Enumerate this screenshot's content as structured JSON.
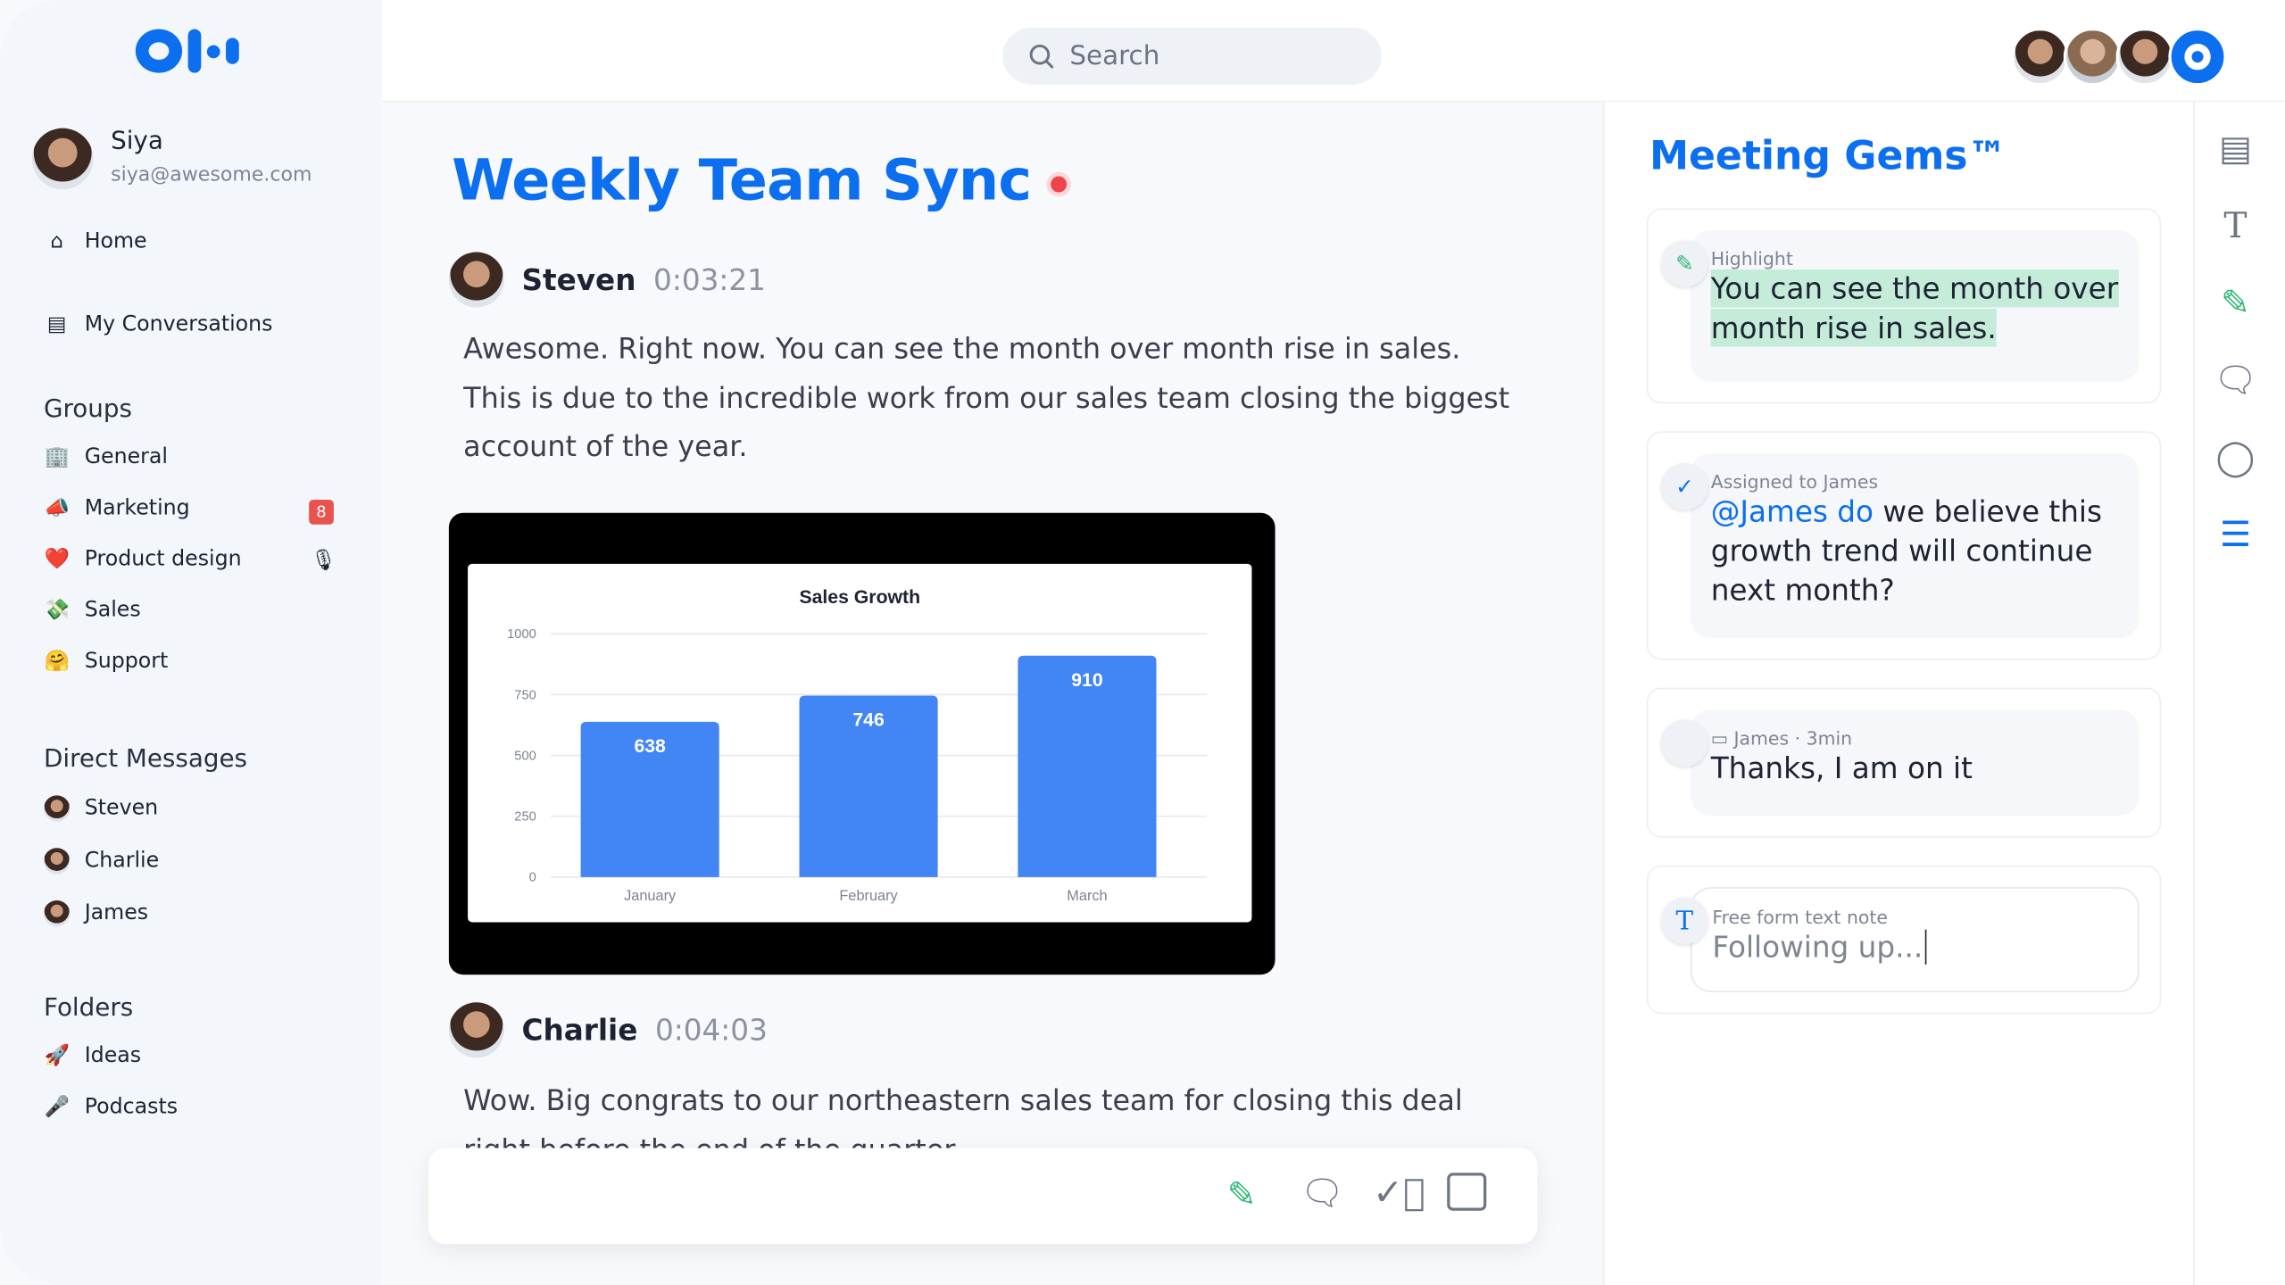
{
  "app": {
    "search_placeholder": "Search",
    "brand_color": "#0b6ff0"
  },
  "user": {
    "name": "Siya",
    "email": "siya@awesome.com"
  },
  "nav": [
    {
      "label": "Home",
      "icon": "home-icon"
    },
    {
      "label": "My Conversations",
      "icon": "document-icon"
    }
  ],
  "groups": {
    "title": "Groups",
    "items": [
      {
        "label": "General",
        "icon": "🏢"
      },
      {
        "label": "Marketing",
        "icon": "📣",
        "badge": "8"
      },
      {
        "label": "Product design",
        "icon": "❤️",
        "status_icon": "recording-icon"
      },
      {
        "label": "Sales",
        "icon": "💸"
      },
      {
        "label": "Support",
        "icon": "🤗"
      }
    ]
  },
  "dms": {
    "title": "Direct Messages",
    "items": [
      {
        "label": "Steven"
      },
      {
        "label": "Charlie"
      },
      {
        "label": "James"
      }
    ]
  },
  "folders": {
    "title": "Folders",
    "items": [
      {
        "label": "Ideas",
        "icon": "🚀"
      },
      {
        "label": "Podcasts",
        "icon": "🎤"
      }
    ]
  },
  "meeting": {
    "title": "Weekly Team Sync",
    "live_color": "#f0444c"
  },
  "transcript": [
    {
      "speaker": "Steven",
      "time": "0:03:21",
      "text": "Awesome. Right now. You can see the month over month rise in sales. This is due to the incredible work from our sales team closing the biggest account of the year."
    },
    {
      "speaker": "Charlie",
      "time": "0:04:03",
      "text": "Wow. Big congrats to our northeastern sales team for closing this deal right before the end of the quarter."
    }
  ],
  "chart_data": {
    "type": "bar",
    "title": "Sales Growth",
    "categories": [
      "January",
      "February",
      "March"
    ],
    "values": [
      638,
      746,
      910
    ],
    "ylim": [
      0,
      1000
    ],
    "yticks": [
      0,
      250,
      500,
      750,
      1000
    ],
    "grid": true,
    "color": "#4285f4"
  },
  "gems": {
    "title": "Meeting Gems™",
    "highlight": {
      "label": "Highlight",
      "text_line1": "You can see the month over",
      "text_line2": "month rise in sales."
    },
    "assigned": {
      "label": "Assigned to James",
      "mention": "@James do",
      "text": " we believe this growth trend will continue next month?"
    },
    "comment": {
      "author": "James",
      "time": "3min",
      "sep": " · ",
      "text": "Thanks, I am on it"
    },
    "note": {
      "label": "Free form text note",
      "value": "Following up..."
    }
  }
}
